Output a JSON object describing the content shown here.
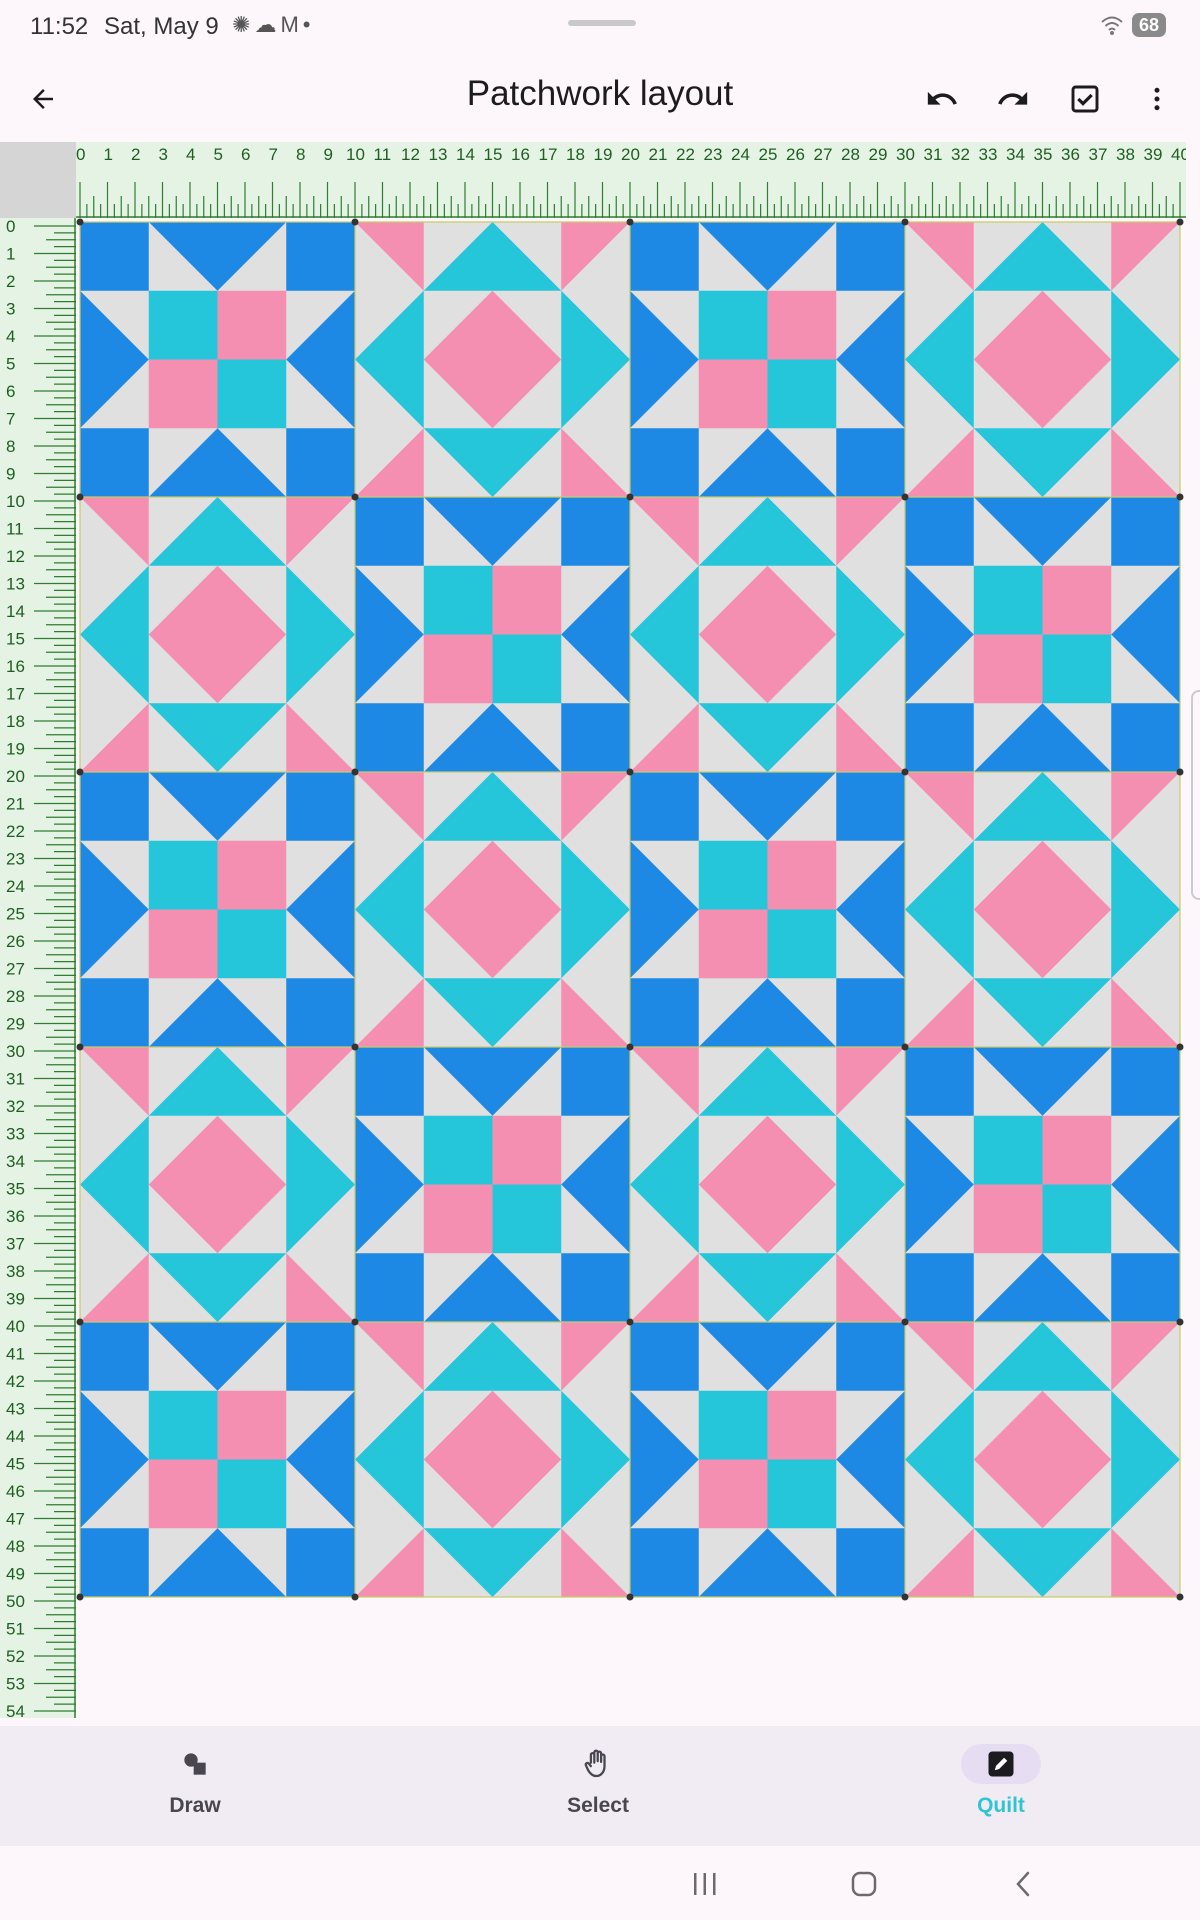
{
  "status_bar": {
    "time": "11:52",
    "date": "Sat, May 9",
    "notification_icons": [
      "openai-icon",
      "cloud-icon",
      "gmail-icon",
      "more-dot"
    ],
    "battery": "68"
  },
  "app_bar": {
    "title": "Patchwork layout",
    "actions": [
      "back-arrow-icon",
      "undo-icon",
      "redo-icon",
      "checkbox-icon",
      "more-vert-icon"
    ]
  },
  "rulers": {
    "top_labels": [
      "0",
      "1",
      "2",
      "3",
      "4",
      "5",
      "6",
      "7",
      "8",
      "9",
      "10",
      "11",
      "12",
      "13",
      "14",
      "15",
      "16",
      "17",
      "18",
      "19",
      "20",
      "21",
      "22",
      "23",
      "24",
      "25",
      "26",
      "27",
      "28",
      "29",
      "30",
      "31",
      "32",
      "33",
      "34",
      "35",
      "36",
      "37",
      "38",
      "39",
      "40"
    ],
    "left_labels": [
      "0",
      "1",
      "2",
      "3",
      "4",
      "5",
      "6",
      "7",
      "8",
      "9",
      "10",
      "11",
      "12",
      "13",
      "14",
      "15",
      "16",
      "17",
      "18",
      "19",
      "20",
      "21",
      "22",
      "23",
      "24",
      "25",
      "26",
      "27",
      "28",
      "29",
      "30",
      "31",
      "32",
      "33",
      "34",
      "35",
      "36",
      "37",
      "38",
      "39",
      "40",
      "41",
      "42",
      "43",
      "44",
      "45",
      "46",
      "47",
      "48",
      "49",
      "50",
      "51",
      "52",
      "53",
      "54"
    ],
    "color": "#2e7d32"
  },
  "quilt": {
    "columns": 4,
    "rows": 5,
    "block_pattern": [
      [
        "star",
        "square-in-square",
        "star",
        "square-in-square"
      ],
      [
        "square-in-square",
        "star",
        "square-in-square",
        "star"
      ],
      [
        "star",
        "square-in-square",
        "star",
        "square-in-square"
      ],
      [
        "square-in-square",
        "star",
        "square-in-square",
        "star"
      ],
      [
        "star",
        "square-in-square",
        "star",
        "square-in-square"
      ]
    ],
    "colors": {
      "blue": "#1e88e5",
      "cyan": "#26c6da",
      "pink": "#f48fb1",
      "gray": "#e0e0e0",
      "seam": "#c5cc6a"
    }
  },
  "bottom_nav": {
    "items": [
      {
        "label": "Draw",
        "icon": "shapes-icon",
        "active": false
      },
      {
        "label": "Select",
        "icon": "hand-icon",
        "active": false
      },
      {
        "label": "Quilt",
        "icon": "edit-icon",
        "active": true
      }
    ]
  },
  "system_nav": [
    "recents-icon",
    "home-icon",
    "back-icon"
  ]
}
